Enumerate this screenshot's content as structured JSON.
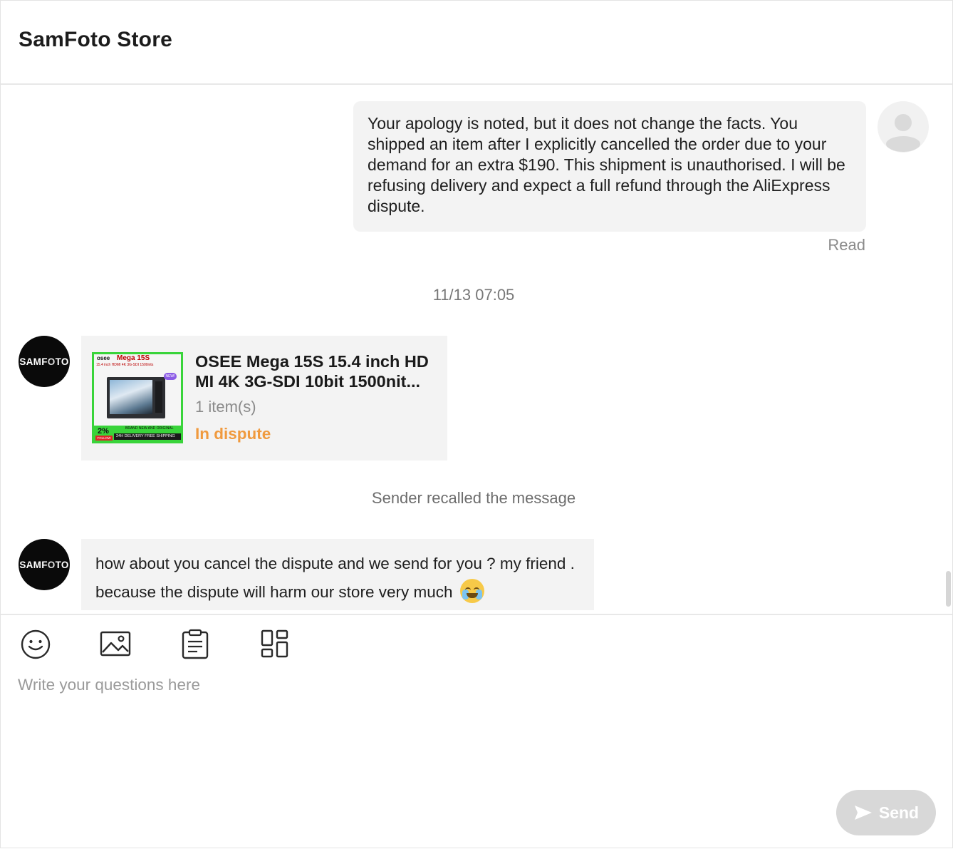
{
  "header": {
    "title": "SamFoto Store"
  },
  "messages": {
    "outgoing_text": "Your apology is noted, but it does not change the facts. You shipped an item after I explicitly cancelled the order due to your demand for an extra $190. This shipment is unauthorised. I will be refusing delivery and expect a full refund through the AliExpress dispute.",
    "read_status": "Read",
    "timestamp": "11/13 07:05",
    "store_avatar_text_a": "SAMF",
    "store_avatar_text_b": "O",
    "store_avatar_text_c": "TO",
    "product": {
      "title_line1": "OSEE Mega 15S 15.4 inch HD",
      "title_line2": "MI 4K 3G-SDI 10bit 1500nit...",
      "quantity": "1 item(s)",
      "status": "In dispute",
      "status_color": "#f09a3e",
      "thumb": {
        "logo": "osee",
        "model": "Mega 15S",
        "tags": "15.4 inch   HDMI 4K   3G-SDI   1500nits",
        "badge": "NEW!",
        "percent": "2%",
        "follow": "FOLLOW",
        "brand_line": "BRAND NEW AND ORIGINAL",
        "shipping": "24H DELIVERY FREE SHIPPING"
      }
    },
    "recalled_notice": "Sender recalled the message",
    "incoming_text": "how about you cancel the dispute and we send for you ? my friend . because the dispute will harm our store very much",
    "incoming_emoji": "crying-laughing-face"
  },
  "composer": {
    "tools": [
      "emoji-icon",
      "image-icon",
      "order-list-icon",
      "product-grid-icon"
    ],
    "placeholder": "Write your questions here",
    "send_label": "Send"
  },
  "colors": {
    "accent_orange": "#f09a3e",
    "bubble_bg": "#f3f3f3",
    "send_disabled": "#d8d8d8"
  }
}
